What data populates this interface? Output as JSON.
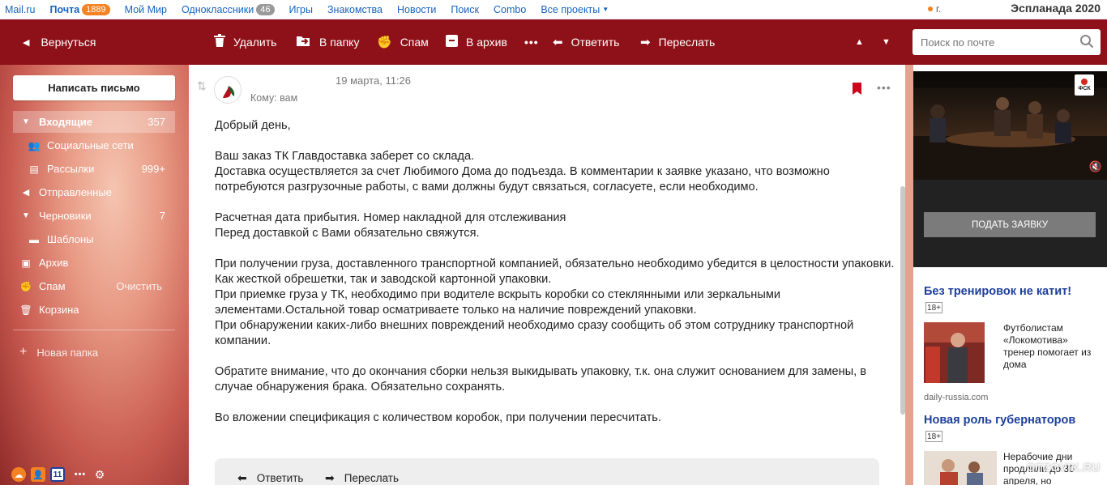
{
  "topnav": {
    "links": [
      "Mail.ru",
      "Почта",
      "Мой Мир",
      "Одноклассники",
      "Игры",
      "Знакомства",
      "Новости",
      "Поиск",
      "Combo",
      "Все проекты"
    ],
    "pochta_badge": "1889",
    "ok_badge": "46",
    "user": "г.",
    "weather": "Эспланада 2020"
  },
  "toolbar": {
    "back": "Вернуться",
    "delete": "Удалить",
    "to_folder": "В папку",
    "spam": "Спам",
    "archive": "В архив",
    "reply": "Ответить",
    "forward": "Переслать",
    "search_placeholder": "Поиск по почте"
  },
  "sidebar": {
    "compose": "Написать письмо",
    "items": [
      {
        "label": "Входящие",
        "count": "357"
      },
      {
        "label": "Социальные сети",
        "count": ""
      },
      {
        "label": "Рассылки",
        "count": "999+"
      },
      {
        "label": "Отправленные",
        "count": ""
      },
      {
        "label": "Черновики",
        "count": "7"
      },
      {
        "label": "Шаблоны",
        "count": ""
      },
      {
        "label": "Архив",
        "count": ""
      },
      {
        "label": "Спам",
        "count": "",
        "action": "Очистить"
      },
      {
        "label": "Корзина",
        "count": ""
      }
    ],
    "new_folder": "Новая папка",
    "calendar_day": "11"
  },
  "letter": {
    "date": "19 марта, 11:26",
    "to": "Кому: вам",
    "paragraphs": [
      "Добрый день,",
      "Ваш заказ ТК Главдоставка заберет со склада.\nДоставка осуществляется за счет Любимого Дома до подъезда. В комментарии к заявке указано, что возможно потребуются разгрузочные работы, с вами должны будут связаться, согласуете, если необходимо.",
      "Расчетная дата прибытия. Номер накладной для отслеживания\nПеред доставкой с Вами обязательно свяжутся.",
      "При получении груза, доставленного транспортной компанией, обязательно необходимо убедится в целостности упаковки. Как жесткой обрешетки, так и заводской картонной упаковки.\nПри приемке груза у ТК, необходимо при водителе вскрыть коробки со стеклянными или зеркальными элементами.Остальной товар осматриваете только на наличие повреждений упаковки.\nПри обнаружении каких-либо внешних повреждений необходимо сразу сообщить об этом сотруднику транспортной компании.",
      "Обратите внимание, что до окончания сборки нельзя выкидывать упаковку, т.к. она служит основанием для замены, в случае обнаружения брака. Обязательно сохранять.",
      "Во вложении спецификация с количеством коробок, при получении пересчитать."
    ],
    "reply": "Ответить",
    "forward": "Переслать"
  },
  "right": {
    "ad_logo": "ФСК",
    "ad_cta": "Подать заявку",
    "news": [
      {
        "heading": "Без тренировок не катит!",
        "age": "18+",
        "text": "Футболистам «Локомотива» тренер помогает из дома",
        "source": "daily-russia.com"
      },
      {
        "heading": "Новая роль губернаторов",
        "age": "18+",
        "text": "Нерабочие дни продлили до 30 апреля, но"
      }
    ],
    "watermark": "OTZOVIK.RU"
  }
}
